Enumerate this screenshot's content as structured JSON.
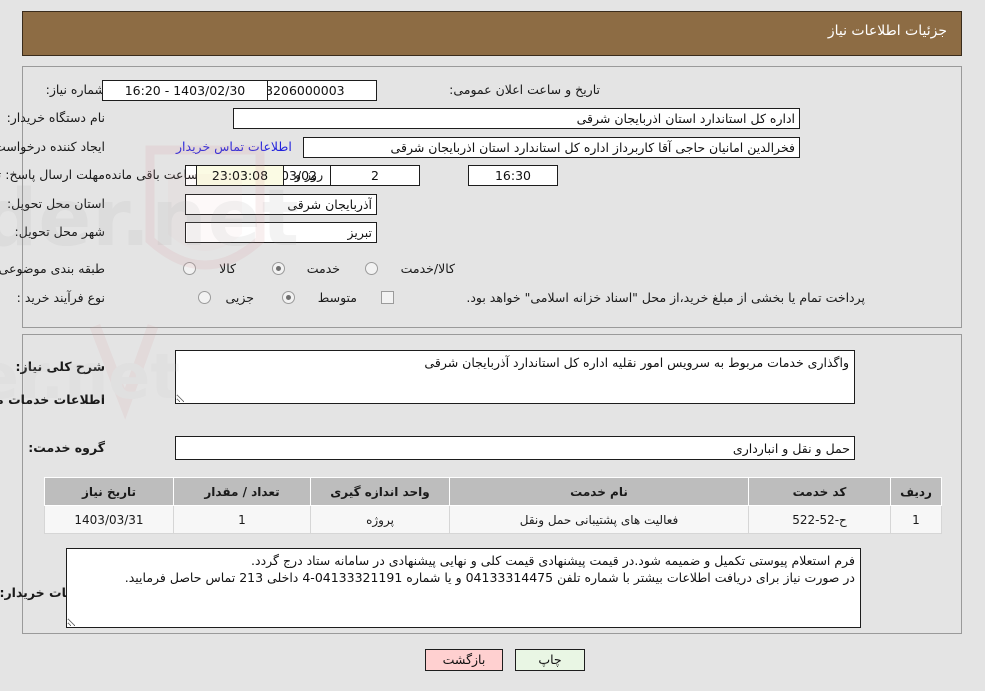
{
  "header": {
    "title": "جزئیات اطلاعات نیاز"
  },
  "top": {
    "need_number_label": "شماره نیاز:",
    "need_number_value": "1103003206000003",
    "announce_label": "تاریخ و ساعت اعلان عمومی:",
    "announce_value": "1403/02/30 - 16:20",
    "buyer_org_label": "نام دستگاه خریدار:",
    "buyer_org_value": "اداره کل استاندارد استان اذربایجان شرقی",
    "creator_label": "ایجاد کننده درخواست:",
    "creator_value": "فخرالدین امانیان حاجی آقا کاربرداز اداره کل استاندارد استان اذربایجان شرقی",
    "contact_link": "اطلاعات تماس خریدار",
    "deadline_label": "مهلت ارسال پاسخ: تا تاریخ:",
    "deadline_date": "1403/03/02",
    "hour_label": "ساعت",
    "hour_value": "16:30",
    "days_value": "2",
    "days_label": "روز و",
    "remaining_value": "23:03:08",
    "remaining_label": "ساعت باقی مانده",
    "province_label": "استان محل تحویل:",
    "province_value": "آذربایجان شرقی",
    "city_label": "شهر محل تحویل:",
    "city_value": "تبریز",
    "category_label": "طبقه بندی موضوعی:",
    "category_options": [
      "کالا",
      "خدمت",
      "کالا/خدمت"
    ],
    "category_selected": "خدمت",
    "process_label": "نوع فرآیند خرید :",
    "process_options": [
      "جزیی",
      "متوسط"
    ],
    "process_selected": "متوسط",
    "treasury_note": "پرداخت تمام یا بخشی از مبلغ خرید،از محل \"اسناد خزانه اسلامی\" خواهد بود."
  },
  "mid": {
    "summary_label": "شرح کلی نیاز:",
    "summary_value": "واگذاری خدمات مربوط به سرویس امور نقلیه اداره کل استاندارد آذربایجان شرقی",
    "section_title": "اطلاعات خدمات مورد نیاز",
    "service_group_label": "گروه خدمت:",
    "service_group_value": "حمل و نقل و انبارداری",
    "notes_label": "توضیحات خریدار:",
    "notes_value": "فرم استعلام پیوستی تکمیل و ضمیمه شود.در قیمت پیشنهادی قیمت کلی و نهایی پیشنهادی در سامانه ستاد درج گردد.\nدر صورت نیاز برای دریافت اطلاعات بیشتر با شماره تلفن 04133314475 و یا شماره 04133321191-4 داخلی 213 تماس حاصل فرمایید."
  },
  "table": {
    "headers": [
      "ردیف",
      "کد خدمت",
      "نام خدمت",
      "واحد اندازه گیری",
      "تعداد / مقدار",
      "تاریخ نیاز"
    ],
    "rows": [
      {
        "row": "1",
        "code": "ح-52-522",
        "name": "فعالیت های پشتیبانی حمل ونقل",
        "unit": "پروژه",
        "qty": "1",
        "date": "1403/03/31"
      }
    ]
  },
  "footer": {
    "back_label": "بازگشت",
    "print_label": "چاپ"
  },
  "watermark": {
    "text": "AriaTender.net"
  },
  "colors": {
    "header_bg": "#8d6c44",
    "link": "#2222dd",
    "back_btn": "#ffd0d0",
    "print_btn": "#e9f6e4",
    "table_header": "#bdbdbd",
    "timer_bg": "#fbfbe4"
  }
}
